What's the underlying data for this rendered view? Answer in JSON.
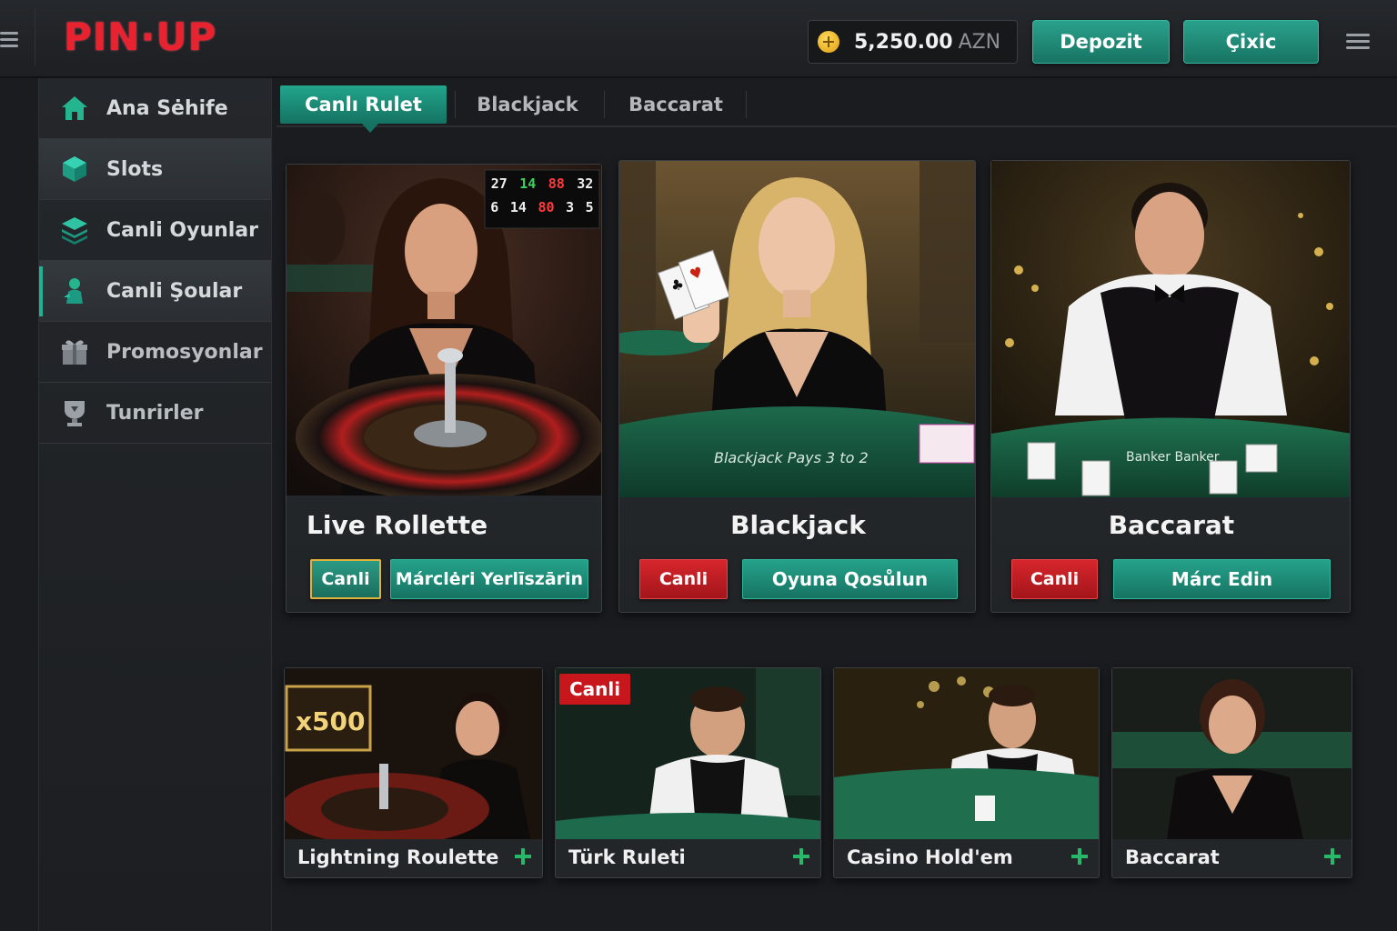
{
  "header": {
    "logo": "PIN·UP",
    "balance_amount": "5,250.00",
    "balance_currency": "AZN",
    "deposit_label": "Depozit",
    "withdraw_label": "Çixic"
  },
  "sidebar": {
    "items": [
      {
        "label": "Ana Sėhife",
        "icon": "home-icon"
      },
      {
        "label": "Slots",
        "icon": "cube-icon"
      },
      {
        "label": "Canli Oyunlar",
        "icon": "layers-icon"
      },
      {
        "label": "Canli Şoular",
        "icon": "performer-icon"
      },
      {
        "label": "Promosyonlar",
        "icon": "gift-icon"
      },
      {
        "label": "Tunrirler",
        "icon": "trophy-icon"
      }
    ]
  },
  "tabs": [
    "Canlı Rulet",
    "Blackjack",
    "Baccarat"
  ],
  "featured": [
    {
      "title": "Live Rollette",
      "badge": "Canli",
      "action": "Márclėri Yerlīszārin",
      "scoreboard": [
        "27",
        "14",
        "88",
        "32",
        "6",
        "14",
        "80",
        "3",
        "5"
      ]
    },
    {
      "title": "Blackjack",
      "badge": "Canli",
      "action": "Oyuna Qosůlun",
      "felt_text": "Blackjack Pays 3 to 2"
    },
    {
      "title": "Baccarat",
      "badge": "Canli",
      "action": "Márc Edin",
      "felt_text": "Banker Banker"
    }
  ],
  "more_games": [
    {
      "title": "Lightning Roulette",
      "overlay": "x500"
    },
    {
      "title": "Türk Ruleti",
      "badge": "Canli"
    },
    {
      "title": "Casino Hold'em"
    },
    {
      "title": "Baccarat"
    }
  ],
  "colors": {
    "accent": "#21b193",
    "brand_red": "#e8222f",
    "live_red": "#c8161d",
    "plus_green": "#27b86a"
  }
}
